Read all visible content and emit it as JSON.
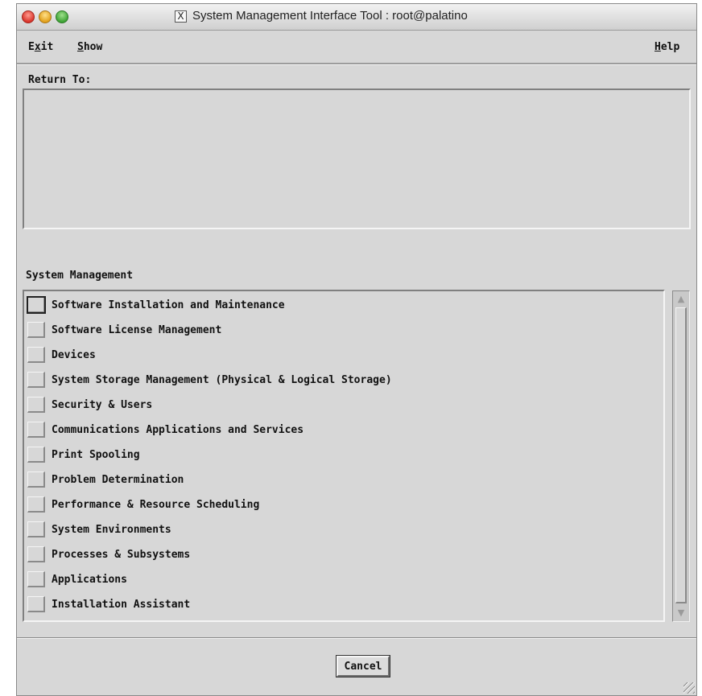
{
  "window": {
    "title": "System Management Interface Tool : root@palatino",
    "x_icon": "X"
  },
  "menu": {
    "exit": {
      "mnemonic": "x",
      "before": "E",
      "after": "it"
    },
    "show": {
      "mnemonic": "S",
      "before": "",
      "after": "how"
    },
    "help": {
      "mnemonic": "H",
      "before": "",
      "after": "elp"
    }
  },
  "return_to": {
    "label": "Return To:"
  },
  "section": {
    "label": "System Management"
  },
  "items": [
    "Software Installation and Maintenance",
    "Software License Management",
    "Devices",
    "System Storage Management (Physical & Logical Storage)",
    "Security & Users",
    "Communications Applications and Services",
    "Print Spooling",
    "Problem Determination",
    "Performance & Resource Scheduling",
    "System Environments",
    "Processes & Subsystems",
    "Applications",
    "Installation Assistant"
  ],
  "buttons": {
    "cancel": "Cancel"
  },
  "icons": {
    "scroll_up": "▲",
    "scroll_down": "▼"
  }
}
